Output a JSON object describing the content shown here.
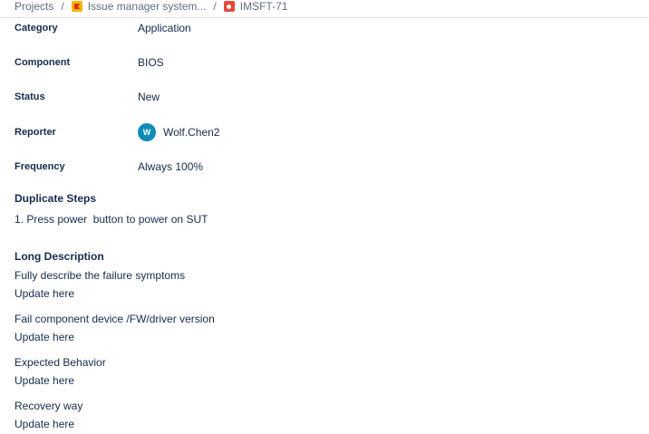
{
  "breadcrumb": {
    "projects": "Projects",
    "separator": "/",
    "project": "Issue manager system...",
    "issue_key": "IMSFT-71"
  },
  "fields": [
    {
      "label": "Category",
      "value": "Application"
    },
    {
      "label": "Component",
      "value": "BIOS"
    },
    {
      "label": "Status",
      "value": "New"
    },
    {
      "label": "Reporter",
      "value": "Wolf.Chen2",
      "avatar_initial": "W",
      "avatar_color": "#0f8bb8"
    },
    {
      "label": "Frequency",
      "value": "Always 100%"
    }
  ],
  "duplicate_steps": {
    "title": "Duplicate Steps",
    "step1": "1. Press power  button to power on SUT"
  },
  "long_description": {
    "title": "Long Description",
    "lines": [
      "Fully describe the failure symptoms",
      "Update here",
      "Fail component device /FW/driver version",
      "Update here",
      "Expected Behavior",
      "Update here",
      "Recovery way",
      "Update here"
    ]
  }
}
